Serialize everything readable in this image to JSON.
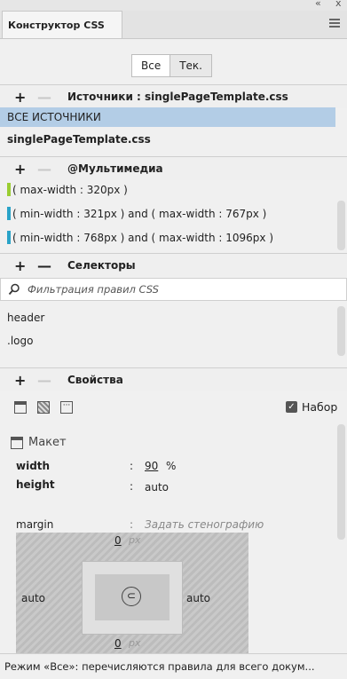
{
  "panel": {
    "tab_label": "Конструктор CSS",
    "collapse_icon": "«",
    "close_icon": "x"
  },
  "mode_toggle": {
    "all_label": "Все",
    "current_label": "Тек."
  },
  "sources": {
    "title": "Источники :  singlePageTemplate.css",
    "items": [
      {
        "label": "ВСЕ ИСТОЧНИКИ",
        "selected": true
      },
      {
        "label": "singlePageTemplate.css",
        "selected": false
      }
    ]
  },
  "media": {
    "title": "@Мультимедиа",
    "items": [
      {
        "label": "( max-width : 320px )",
        "color": "#9acd32"
      },
      {
        "label": "( min-width : 321px ) and ( max-width : 767px )",
        "color": "#29a3c8"
      },
      {
        "label": "( min-width : 768px ) and ( max-width : 1096px )",
        "color": "#29a3c8"
      }
    ]
  },
  "selectors": {
    "title": "Селекторы",
    "filter_placeholder": "Фильтрация правил CSS",
    "items": [
      "header",
      ".logo"
    ]
  },
  "properties": {
    "title": "Свойства",
    "set_label": "Набор",
    "set_checked": true,
    "layout_label": "Макет",
    "width_label": "width",
    "width_value": "90",
    "width_unit": "%",
    "height_label": "height",
    "height_value": "auto",
    "margin_label": "margin",
    "margin_placeholder": "Задать стенографию",
    "box": {
      "top": "0",
      "top_unit": "px",
      "left": "auto",
      "right": "auto",
      "bottom": "0",
      "bottom_unit": "px",
      "link_icon": "⊂"
    }
  },
  "status": {
    "text": "Режим «Все»: перечисляются правила для всего докум..."
  },
  "colors": {
    "selected_row": "#b3cde6",
    "accent_green": "#9acd32",
    "accent_blue": "#29a3c8"
  }
}
